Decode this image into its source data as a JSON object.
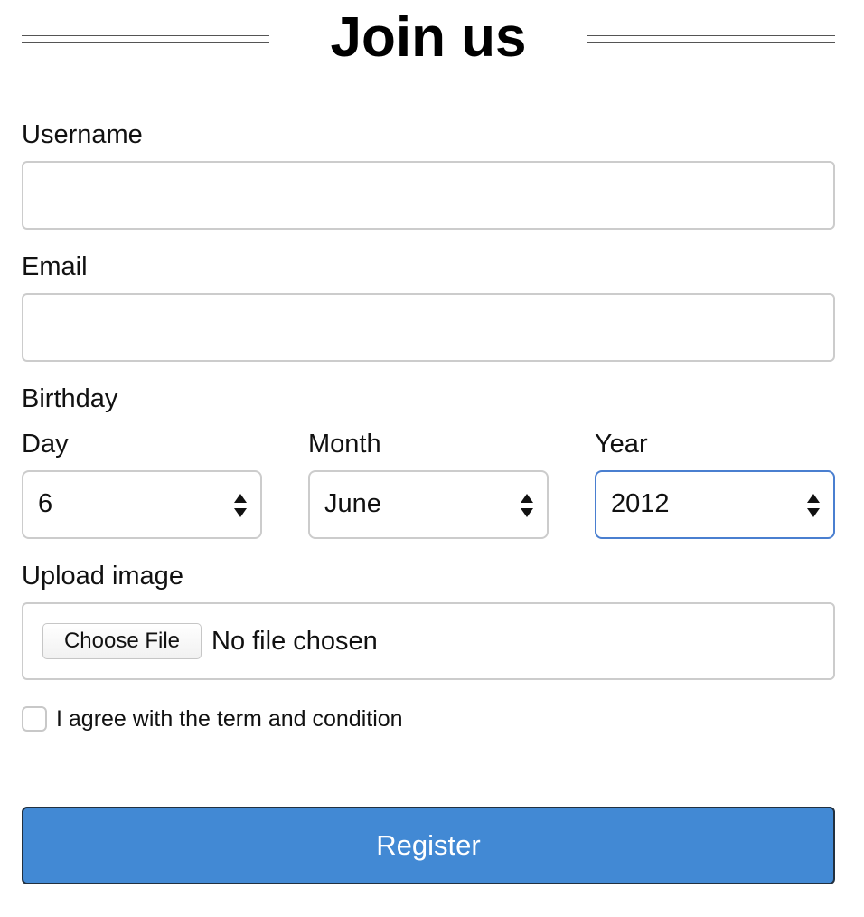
{
  "header": {
    "title": "Join us"
  },
  "form": {
    "username": {
      "label": "Username",
      "value": ""
    },
    "email": {
      "label": "Email",
      "value": ""
    },
    "birthday": {
      "label": "Birthday",
      "day": {
        "label": "Day",
        "value": "6"
      },
      "month": {
        "label": "Month",
        "value": "June"
      },
      "year": {
        "label": "Year",
        "value": "2012",
        "focused": true
      }
    },
    "upload": {
      "label": "Upload image",
      "button_label": "Choose File",
      "status": "No file chosen"
    },
    "agree": {
      "label": "I agree with the term and condition",
      "checked": false
    },
    "register_label": "Register"
  },
  "colors": {
    "register_button": "#4289d4",
    "focus_border": "#4a7fd0",
    "input_border": "#cccccc"
  },
  "icons": {
    "select_arrows": "up-down-arrows-icon"
  }
}
